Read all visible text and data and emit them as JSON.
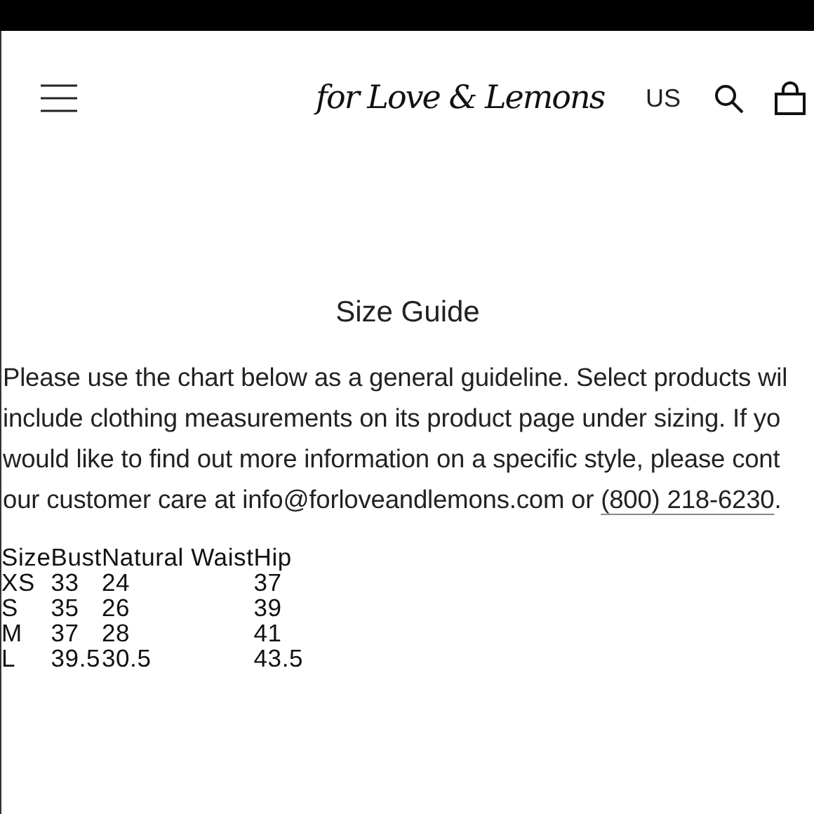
{
  "header": {
    "logo": "for Love & Lemons",
    "region": "US"
  },
  "title": "Size Guide",
  "paragraph_lines": [
    {
      "text": "Please use the chart below as a general guideline. Select products wil"
    },
    {
      "text": "include clothing measurements on its product page under sizing. If yo"
    },
    {
      "text": "would like to find out more information on a specific style, please cont"
    },
    {
      "text": "our customer care at info@forloveandlemons.com or ",
      "link": "(800) 218-6230",
      "after": "."
    }
  ],
  "table": {
    "columns": [
      "Size",
      "Bust",
      "Natural Waist",
      "Hip"
    ],
    "rows": [
      [
        "XS",
        "33",
        "24",
        "37"
      ],
      [
        "S",
        "35",
        "26",
        "39"
      ],
      [
        "M",
        "37",
        "28",
        "41"
      ],
      [
        "L",
        "39.5",
        "30.5",
        "43.5"
      ]
    ]
  }
}
